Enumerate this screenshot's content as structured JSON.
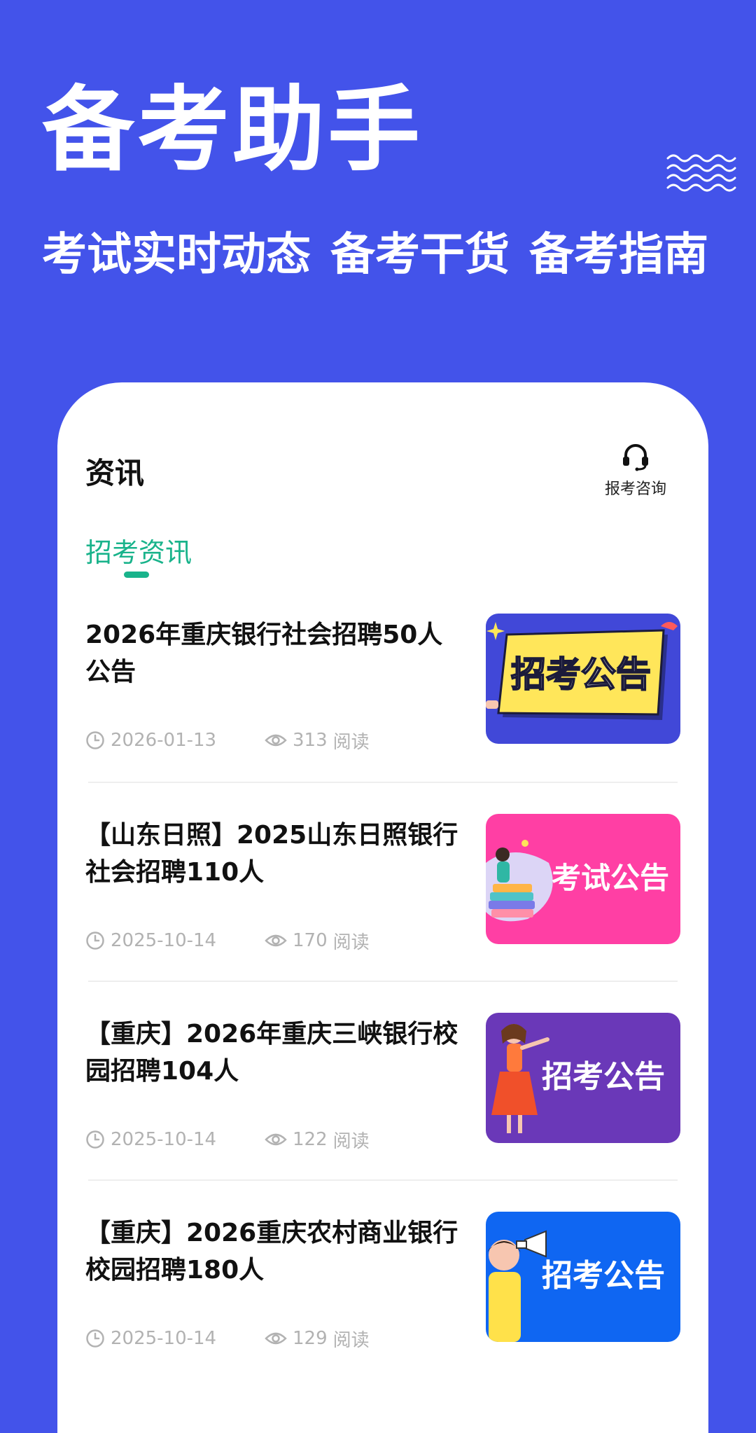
{
  "hero": {
    "title": "备考助手",
    "subtitle_parts": [
      "考试实时动态",
      "备考干货",
      "备考指南"
    ]
  },
  "header": {
    "title": "资讯",
    "consult_label": "报考咨询"
  },
  "tabs": [
    {
      "label": "招考资讯",
      "active": true
    }
  ],
  "articles": [
    {
      "title": "2026年重庆银行社会招聘50人公告",
      "date": "2026-01-13",
      "views": "313",
      "views_unit": "阅读",
      "thumb_text": "招考公告"
    },
    {
      "title": "【山东日照】2025山东日照银行社会招聘110人",
      "date": "2025-10-14",
      "views": "170",
      "views_unit": "阅读",
      "thumb_text": "考试公告"
    },
    {
      "title": "【重庆】2026年重庆三峡银行校园招聘104人",
      "date": "2025-10-14",
      "views": "122",
      "views_unit": "阅读",
      "thumb_text": "招考公告"
    },
    {
      "title": "【重庆】2026重庆农村商业银行校园招聘180人",
      "date": "2025-10-14",
      "views": "129",
      "views_unit": "阅读",
      "thumb_text": "招考公告"
    }
  ],
  "colors": {
    "background": "#4353EA",
    "accent": "#19B38B",
    "thumb_1": "#4148D8",
    "thumb_2": "#FF3FA4",
    "thumb_3": "#6A38B8",
    "thumb_4": "#0F66F2"
  },
  "icons": {
    "wave": "wave-lines-icon",
    "consult": "headset-icon",
    "date": "clock-icon",
    "views": "eye-icon"
  }
}
